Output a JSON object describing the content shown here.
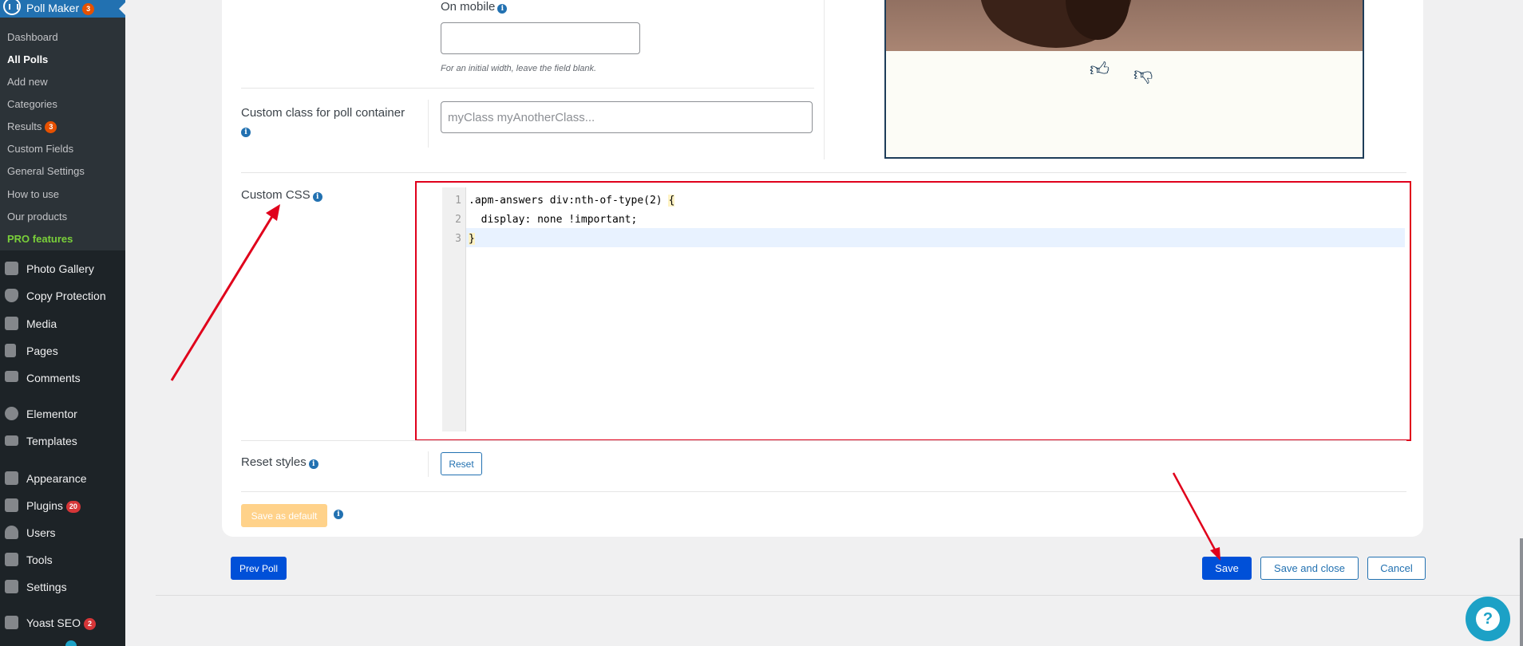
{
  "sidebar": {
    "title": "Poll Maker",
    "title_badge": "3",
    "submenu": [
      {
        "label": "Dashboard"
      },
      {
        "label": "All Polls"
      },
      {
        "label": "Add new"
      },
      {
        "label": "Categories"
      },
      {
        "label": "Results",
        "badge": "3"
      },
      {
        "label": "Custom Fields"
      },
      {
        "label": "General Settings"
      },
      {
        "label": "How to use"
      },
      {
        "label": "Our products"
      },
      {
        "label": "PRO features"
      }
    ],
    "menu": [
      {
        "label": "Photo Gallery",
        "icon": "gallery-icon"
      },
      {
        "label": "Copy Protection",
        "icon": "shield-icon"
      },
      {
        "label": "Media",
        "icon": "media-icon"
      },
      {
        "label": "Pages",
        "icon": "pages-icon"
      },
      {
        "label": "Comments",
        "icon": "comments-icon"
      },
      {
        "label": "Elementor",
        "icon": "elementor-icon"
      },
      {
        "label": "Templates",
        "icon": "folder-icon"
      },
      {
        "label": "Appearance",
        "icon": "brush-icon"
      },
      {
        "label": "Plugins",
        "badge": "20",
        "icon": "plugin-icon"
      },
      {
        "label": "Users",
        "icon": "user-icon"
      },
      {
        "label": "Tools",
        "icon": "wrench-icon"
      },
      {
        "label": "Settings",
        "icon": "settings-icon"
      },
      {
        "label": "Yoast SEO",
        "badge": "2",
        "icon": "yoast-icon"
      }
    ]
  },
  "form": {
    "mobile_label": "On mobile",
    "mobile_value": "",
    "mobile_hint": "For an initial width, leave the field blank.",
    "custom_class_label": "Custom class for poll container",
    "custom_class_placeholder": "myClass myAnotherClass...",
    "custom_css_label": "Custom CSS",
    "css_lines": [
      {
        "n": "1",
        "text": ".apm-answers div:nth-of-type(2) ",
        "brace": "{"
      },
      {
        "n": "2",
        "text": "  display: none !important;",
        "brace": ""
      },
      {
        "n": "3",
        "text": "",
        "brace": "}"
      }
    ],
    "reset_label": "Reset styles",
    "reset_button": "Reset",
    "save_default_button": "Save as default"
  },
  "preview": {
    "like_icon": "thumbs-up-icon",
    "dislike_icon": "thumbs-down-icon"
  },
  "actions": {
    "prev_poll": "Prev Poll",
    "save": "Save",
    "save_close": "Save and close",
    "cancel": "Cancel"
  },
  "colors": {
    "annotation": "#e0001b",
    "primary": "#0050d8"
  }
}
